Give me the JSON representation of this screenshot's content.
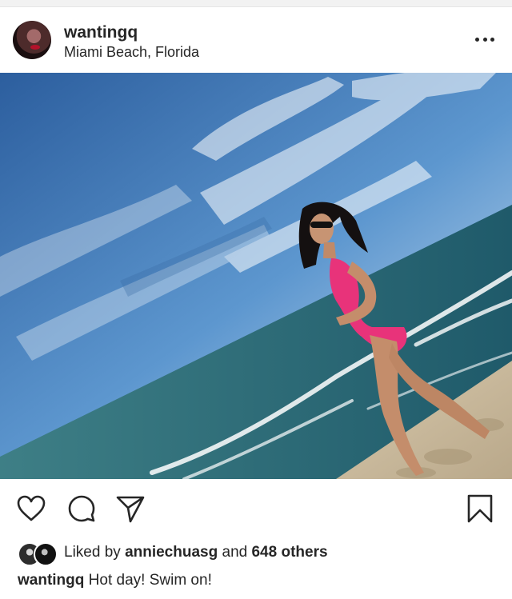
{
  "post": {
    "username": "wantingq",
    "location": "Miami Beach, Florida"
  },
  "icons": {
    "more": "more-options-icon",
    "like": "heart-icon",
    "comment": "comment-bubble-icon",
    "share": "paper-plane-icon",
    "save": "bookmark-icon"
  },
  "likes": {
    "prefix": "Liked by",
    "first_liker": "anniechuasg",
    "connector": "and",
    "others": "648 others"
  },
  "caption": {
    "username": "wantingq",
    "text": "Hot day! Swim on!"
  },
  "colors": {
    "text": "#262626",
    "background": "#ffffff",
    "swimsuit": "#e8337a",
    "sky": "#3f78b5",
    "sea": "#2e6e73"
  }
}
